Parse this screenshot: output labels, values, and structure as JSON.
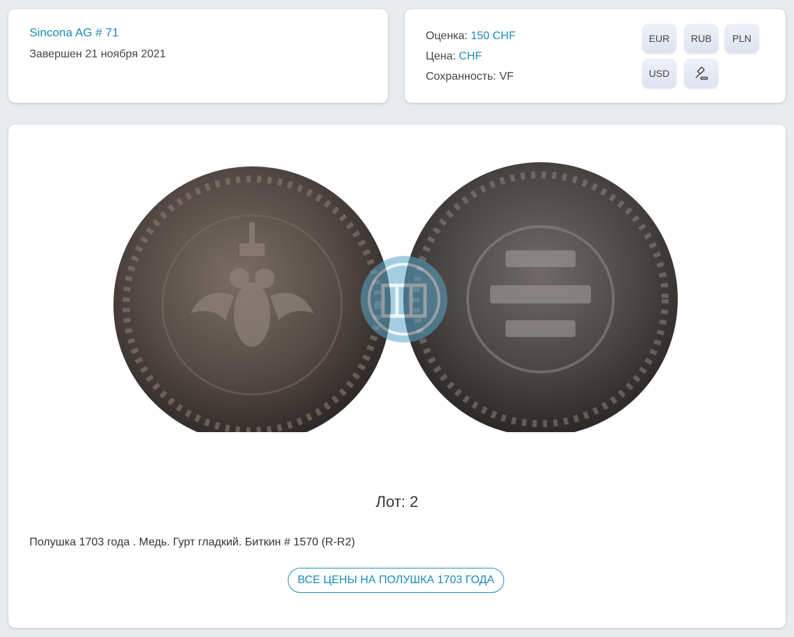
{
  "auction": {
    "name": "Sincona AG # 71",
    "date": "Завершен 21 ноября 2021"
  },
  "price": {
    "estimate_label": "Оценка: ",
    "estimate_value": "150 CHF",
    "price_label": "Цена: ",
    "price_value": "CHF",
    "condition_label": "Сохранность: ",
    "condition_value": "VF"
  },
  "currencies": [
    "EUR",
    "RUB",
    "PLN",
    "USD"
  ],
  "lot": {
    "title": "Лот: 2",
    "description": "Полушка 1703 года . Медь. Гурт гладкий. Биткин # 1570 (R-R2)",
    "all_prices_button": "ВСЕ ЦЕНЫ НА ПОЛУШКА 1703 ГОДА"
  },
  "colors": {
    "accent": "#1d8cb8",
    "coin_dark": "#3f3a38",
    "coin_mid": "#6b605a"
  }
}
